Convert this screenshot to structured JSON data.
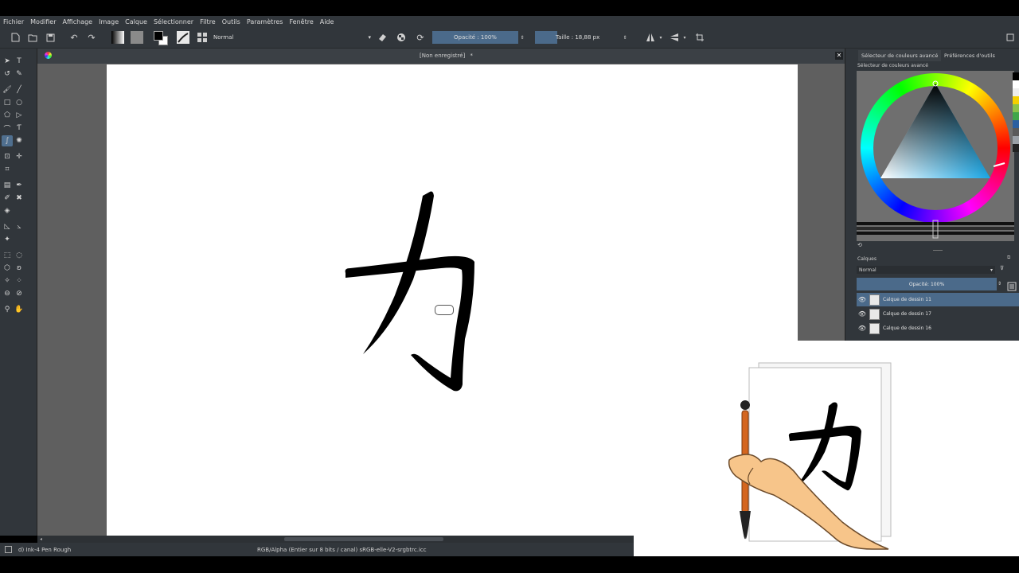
{
  "menu": [
    "Fichier",
    "Modifier",
    "Affichage",
    "Image",
    "Calque",
    "Sélectionner",
    "Filtre",
    "Outils",
    "Paramètres",
    "Fenêtre",
    "Aide"
  ],
  "toolbar": {
    "blend_mode": "Normal",
    "opacity_label": "Opacité : 100%",
    "size_label": "Taille : 18,88 px"
  },
  "document": {
    "tab_title": "[Non enregistré]",
    "modified_mark": "*"
  },
  "status": {
    "brush": "d) Ink-4 Pen Rough",
    "colorspace": "RGB/Alpha (Entier sur 8 bits / canal) sRGB-elle-V2-srgbtrc.icc"
  },
  "docker": {
    "tab_color": "Sélecteur de couleurs avancé",
    "tab_prefs": "Préférences d'outils",
    "panel_title": "Sélecteur de couleurs avancé",
    "layers_title": "Calques",
    "layers_blend": "Normal",
    "layers_opacity": "Opacité:  100%",
    "layers": [
      {
        "name": "Calque de dessin 11",
        "selected": true
      },
      {
        "name": "Calque de dessin 17",
        "selected": false
      },
      {
        "name": "Calque de dessin 16",
        "selected": false
      }
    ]
  },
  "colors": {
    "accent": "#4b6a8a",
    "panel": "#31363b",
    "canvas_bg": "#5f5f5f"
  },
  "icons": [
    "new-document-icon",
    "open-icon",
    "save-icon",
    "undo-icon",
    "redo-icon",
    "gradient-icon",
    "pattern-icon",
    "fg-bg-color-icon",
    "brush-preset-icon",
    "grid-icon",
    "eraser-icon",
    "alpha-lock-icon",
    "reload-icon",
    "mirror-h-icon",
    "mirror-v-icon",
    "wrap-icon",
    "eye-icon"
  ]
}
